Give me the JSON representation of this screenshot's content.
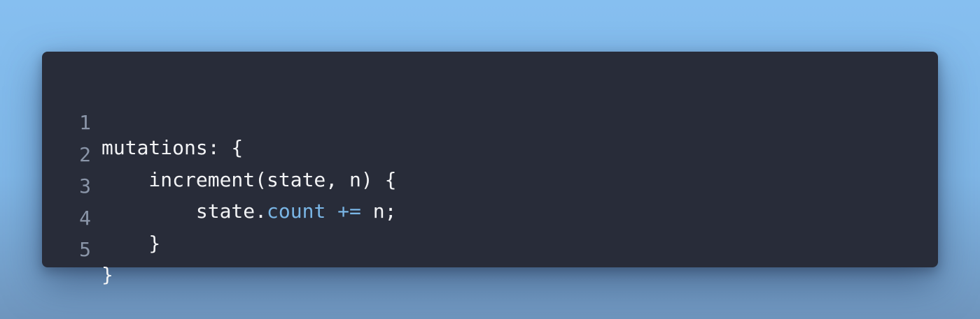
{
  "editor": {
    "lines": [
      {
        "number": "1",
        "tokens": [
          {
            "text": "mutations: {",
            "kind": "plain"
          }
        ]
      },
      {
        "number": "2",
        "tokens": [
          {
            "text": "    increment(state, n) {",
            "kind": "plain"
          }
        ]
      },
      {
        "number": "3",
        "tokens": [
          {
            "text": "        state.",
            "kind": "plain"
          },
          {
            "text": "count",
            "kind": "prop"
          },
          {
            "text": " ",
            "kind": "plain"
          },
          {
            "text": "+=",
            "kind": "op"
          },
          {
            "text": " n;",
            "kind": "plain"
          }
        ]
      },
      {
        "number": "4",
        "tokens": [
          {
            "text": "    }",
            "kind": "plain"
          }
        ]
      },
      {
        "number": "5",
        "tokens": [
          {
            "text": "}",
            "kind": "plain"
          }
        ]
      }
    ]
  },
  "colors": {
    "background_top": "#86bff0",
    "background_bottom": "#6f95bd",
    "card_background": "#282c39",
    "text": "#f2f3f5",
    "line_number": "#8a95a8",
    "property": "#7ab6e6",
    "operator": "#7ab6e6"
  }
}
